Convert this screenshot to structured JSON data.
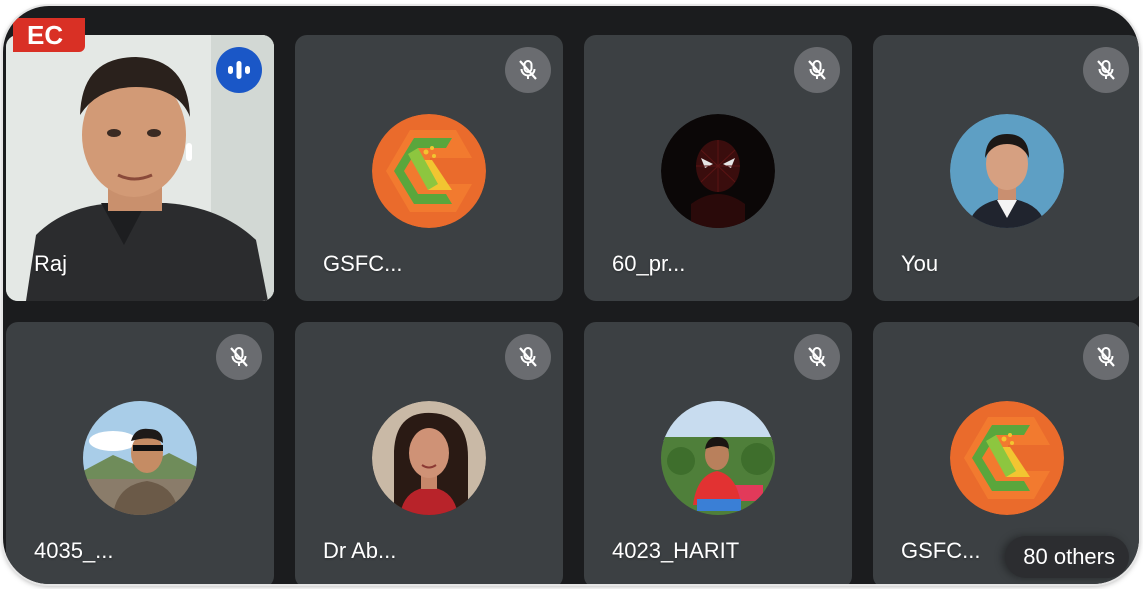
{
  "recording": {
    "label": "EC"
  },
  "participants": [
    {
      "name": "Raj",
      "state": "speaking",
      "tile": "video",
      "icon": "audio-level-icon"
    },
    {
      "name": "GSFC...",
      "state": "muted",
      "tile": "avatar",
      "avatar": "gsfc-logo-icon",
      "icon": "mic-off-icon"
    },
    {
      "name": "60_pr...",
      "state": "muted",
      "tile": "avatar",
      "avatar": "spider-mask-avatar",
      "icon": "mic-off-icon"
    },
    {
      "name": "You",
      "state": "muted",
      "tile": "avatar",
      "avatar": "photo-avatar",
      "icon": "mic-off-icon"
    },
    {
      "name": "4035_...",
      "state": "muted",
      "tile": "avatar",
      "avatar": "photo-avatar",
      "icon": "mic-off-icon"
    },
    {
      "name": "Dr Ab...",
      "state": "muted",
      "tile": "avatar",
      "avatar": "photo-avatar",
      "icon": "mic-off-icon"
    },
    {
      "name": "4023_HARIT",
      "state": "muted",
      "tile": "avatar",
      "avatar": "photo-avatar",
      "icon": "mic-off-icon"
    },
    {
      "name": "GSFC...",
      "state": "muted",
      "tile": "avatar",
      "avatar": "gsfc-logo-icon",
      "icon": "mic-off-icon"
    }
  ],
  "others": {
    "label": "80 others"
  },
  "colors": {
    "background": "#1b1c1e",
    "tile": "#3c4043",
    "rec": "#d93025",
    "speaking": "#1a57c7",
    "mute_chip": "#6a6c70",
    "gsfc_orange": "#ea6b2c",
    "gsfc_green": "#5aa63c",
    "gsfc_yellow": "#f2c531"
  }
}
